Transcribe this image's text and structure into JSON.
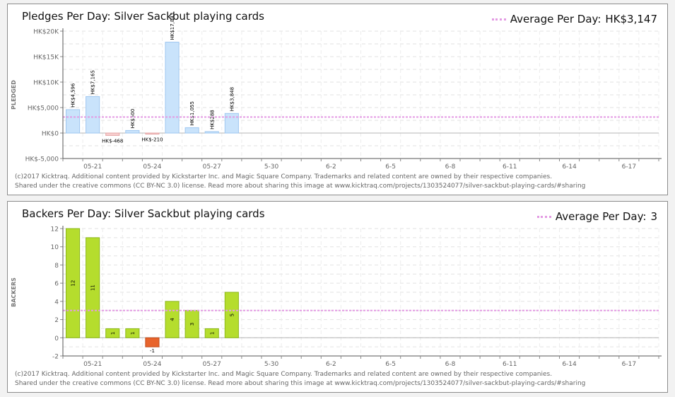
{
  "charts": [
    {
      "id": "pledges",
      "title": "Pledges Per Day: Silver Sackbut playing cards",
      "legend_label": "Average Per Day:",
      "legend_value": "HK$3,147",
      "footer_line1": "(c)2017 Kicktraq. Additional content provided by Kickstarter Inc. and Magic Square Company. Trademarks and related content are owned by their respective companies.",
      "footer_line2": "Shared under the creative commons (CC BY-NC 3.0) license. Read more about sharing this image at www.kicktraq.com/projects/1303524077/silver-sackbut-playing-cards/#sharing"
    },
    {
      "id": "backers",
      "title": "Backers Per Day: Silver Sackbut playing cards",
      "legend_label": "Average Per Day:",
      "legend_value": "3",
      "footer_line1": "(c)2017 Kicktraq. Additional content provided by Kickstarter Inc. and Magic Square Company. Trademarks and related content are owned by their respective companies.",
      "footer_line2": "Shared under the creative commons (CC BY-NC 3.0) license. Read more about sharing this image at www.kicktraq.com/projects/1303524077/silver-sackbut-playing-cards/#sharing"
    }
  ],
  "chart_data": [
    {
      "type": "bar",
      "title": "Pledges Per Day: Silver Sackbut playing cards",
      "ylabel": "PLEDGED",
      "ylim": [
        -5000,
        20000
      ],
      "yticks": [
        -5000,
        0,
        5000,
        10000,
        15000,
        20000
      ],
      "ytick_labels": [
        "HK$-5,000",
        "HK$0",
        "HK$5,000",
        "HK$10K",
        "HK$15K",
        "HK$20K"
      ],
      "x_date_labels": [
        "05-21",
        "05-24",
        "05-27",
        "5-30",
        "6-2",
        "6-5",
        "6-8",
        "6-11",
        "6-14",
        "6-17"
      ],
      "x_first_label_day": 2,
      "x_label_step_days": 3,
      "days_in_range": 30,
      "values": [
        4596,
        7165,
        -468,
        500,
        -210,
        17843,
        1055,
        288,
        3848
      ],
      "value_labels": [
        "HK$4,596",
        "HK$7,165",
        "HK$-468",
        "HK$500",
        "HK$-210",
        "HK$17,843",
        "HK$1,055",
        "HK$288",
        "HK$3,848"
      ],
      "average": 3147,
      "grid": true,
      "positive_color": "#c9e3fb",
      "positive_border": "#9fc7f0",
      "negative_color": "#f7cfcf",
      "negative_border": "#e6a3a3",
      "average_color": "#e39be3"
    },
    {
      "type": "bar",
      "title": "Backers Per Day: Silver Sackbut playing cards",
      "ylabel": "BACKERS",
      "ylim": [
        -2,
        12
      ],
      "yticks": [
        -2,
        0,
        2,
        4,
        6,
        8,
        10,
        12
      ],
      "ytick_labels": [
        "-2",
        "0",
        "2",
        "4",
        "6",
        "8",
        "10",
        "12"
      ],
      "x_date_labels": [
        "05-21",
        "05-24",
        "05-27",
        "5-30",
        "6-2",
        "6-5",
        "6-8",
        "6-11",
        "6-14",
        "6-17"
      ],
      "x_first_label_day": 2,
      "x_label_step_days": 3,
      "days_in_range": 30,
      "values": [
        12,
        11,
        1,
        1,
        -1,
        4,
        3,
        1,
        5
      ],
      "value_labels": [
        "12",
        "11",
        "1",
        "1",
        "-1",
        "4",
        "3",
        "1",
        "5"
      ],
      "average": 3,
      "grid": true,
      "positive_color": "#b5dd2d",
      "positive_border": "#8bb81a",
      "negative_color": "#e8642c",
      "negative_border": "#c04a18",
      "average_color": "#e39be3"
    }
  ]
}
